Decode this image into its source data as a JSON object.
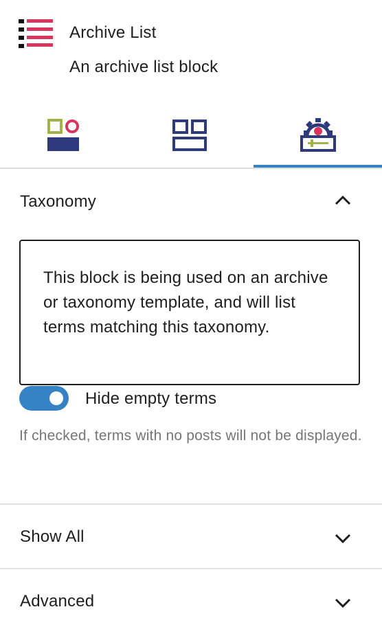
{
  "block": {
    "title": "Archive List",
    "description": "An archive list block",
    "icon": "list-icon"
  },
  "tabs": [
    {
      "icon": "styles-icon",
      "active": false
    },
    {
      "icon": "layout-grid-icon",
      "active": false
    },
    {
      "icon": "settings-gear-icon",
      "active": true
    }
  ],
  "panels": {
    "taxonomy": {
      "title": "Taxonomy",
      "expanded": true,
      "notice": "This block is being used on an archive or taxonomy template, and will list terms matching this taxonomy.",
      "toggle": {
        "label": "Hide empty terms",
        "checked": true,
        "help": "If checked, terms with no posts will not be displayed."
      }
    },
    "show_all": {
      "title": "Show All",
      "expanded": false
    },
    "advanced": {
      "title": "Advanced",
      "expanded": false
    }
  },
  "colors": {
    "accent": "#3582c4",
    "brand_pink": "#d8365f",
    "brand_navy": "#2e3a7b",
    "brand_green": "#a3b34a"
  }
}
